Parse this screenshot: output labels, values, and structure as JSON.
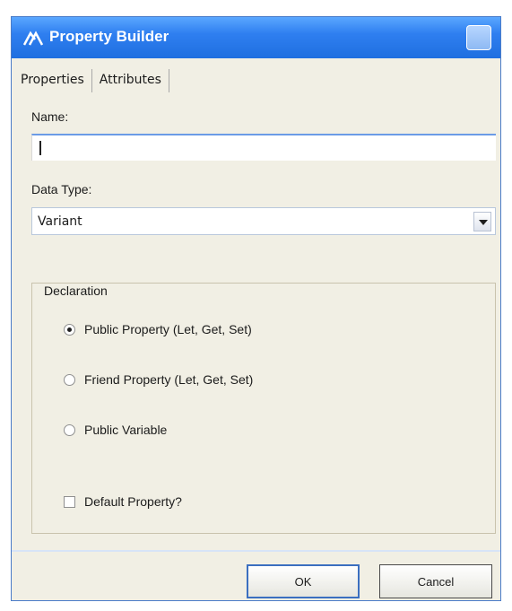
{
  "window": {
    "title": "Property Builder"
  },
  "tabs": [
    {
      "label": "Properties",
      "mnemonic": "P"
    },
    {
      "label": "Attributes",
      "mnemonic": "A"
    }
  ],
  "name_field": {
    "label": "Name:",
    "value": ""
  },
  "data_type": {
    "label": "Data Type:",
    "selected": "Variant"
  },
  "declaration": {
    "legend": "Declaration",
    "options": [
      {
        "label": "Public Property (Let, Get, Set)",
        "checked": true
      },
      {
        "label": "Friend Property (Let, Get, Set)",
        "checked": false
      },
      {
        "label": "Public Variable",
        "checked": false
      }
    ],
    "default_property": {
      "label": "Default Property?",
      "checked": false
    }
  },
  "buttons": {
    "ok": "OK",
    "cancel": "Cancel"
  },
  "colors": {
    "titlebar": "#2f7ff0",
    "dialog_bg": "#f1efe4",
    "ok_border": "#3b6fc0"
  }
}
